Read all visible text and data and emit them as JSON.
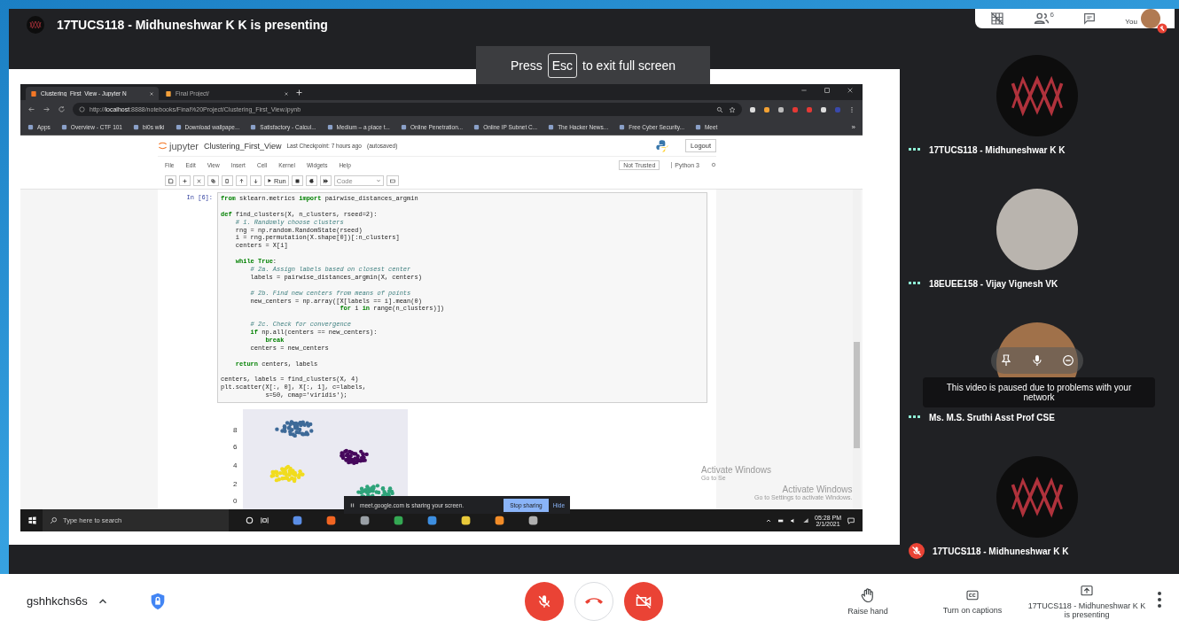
{
  "header": {
    "title": "17TUCS118 - Midhuneshwar K K is presenting"
  },
  "fullscreen_notice": {
    "before": "Press",
    "key": "Esc",
    "after": "to exit full screen"
  },
  "top_controls": {
    "participants_count": "6",
    "self_label": "You",
    "self_muted": true
  },
  "shared_screen": {
    "browser": {
      "tabs": [
        {
          "title": "Clustering_First_View - Jupyter N",
          "selected": true
        },
        {
          "title": "Final Project/",
          "selected": false
        }
      ],
      "url": "http://**localhost**:8888/notebooks/Final%20Project/Clustering_First_View.ipynb",
      "bookmarks": [
        "Apps",
        "Overview - CTF 101",
        "bi0s wiki",
        "Download wallpape...",
        "Satisfactory - Calcul...",
        "Medium – a place t...",
        "Online Penetration...",
        "Online IP Subnet C...",
        "The Hacker News...",
        "Free Cyber Security...",
        "Meet"
      ],
      "bookmarks_overflow": "»"
    },
    "notebook": {
      "logo": "jupyter",
      "name": "Clustering_First_View",
      "checkpoint": "Last Checkpoint: 7 hours ago",
      "autosave": "(autosaved)",
      "logout": "Logout",
      "menu": [
        "File",
        "Edit",
        "View",
        "Insert",
        "Cell",
        "Kernel",
        "Widgets",
        "Help"
      ],
      "trust": "Not Trusted",
      "kernel": "Python 3",
      "run_label": "Run",
      "cell_type": "Code",
      "prompt": "In [6]:",
      "code": [
        {
          "kind": "code",
          "text": "**from** sklearn.metrics **import** pairwise_distances_argmin"
        },
        {
          "kind": "blank"
        },
        {
          "kind": "code",
          "text": "**def** find_clusters(X, n_clusters, rseed=2):"
        },
        {
          "kind": "comment",
          "text": "    # 1. Randomly choose clusters"
        },
        {
          "kind": "code",
          "text": "    rng = np.random.RandomState(rseed)"
        },
        {
          "kind": "code",
          "text": "    i = rng.permutation(X.shape[0])[:n_clusters]"
        },
        {
          "kind": "code",
          "text": "    centers = X[i]"
        },
        {
          "kind": "blank"
        },
        {
          "kind": "code",
          "text": "    **while** **True**:"
        },
        {
          "kind": "comment",
          "text": "        # 2a. Assign labels based on closest center"
        },
        {
          "kind": "code",
          "text": "        labels = pairwise_distances_argmin(X, centers)"
        },
        {
          "kind": "blank"
        },
        {
          "kind": "comment",
          "text": "        # 2b. Find new centers from means of points"
        },
        {
          "kind": "code",
          "text": "        new_centers = np.array([X[labels == i].mean(0)"
        },
        {
          "kind": "code",
          "text": "                                **for** i **in** range(n_clusters)])"
        },
        {
          "kind": "blank"
        },
        {
          "kind": "comment",
          "text": "        # 2c. Check for convergence"
        },
        {
          "kind": "code",
          "text": "        **if** np.all(centers == new_centers):"
        },
        {
          "kind": "code",
          "text": "            **break**"
        },
        {
          "kind": "code",
          "text": "        centers = new_centers"
        },
        {
          "kind": "blank"
        },
        {
          "kind": "code",
          "text": "    **return** centers, labels"
        },
        {
          "kind": "blank"
        },
        {
          "kind": "code",
          "text": "centers, labels = find_clusters(X, 4)"
        },
        {
          "kind": "code",
          "text": "plt.scatter(X[:, 0], X[:, 1], c=labels,"
        },
        {
          "kind": "code",
          "text": "            s=50, cmap='viridis');"
        }
      ],
      "plot_yticks": [
        "8",
        "6",
        "4",
        "2",
        "0"
      ]
    },
    "sharing_bar": {
      "message": "meet.google.com is sharing your screen.",
      "stop": "Stop sharing",
      "hide": "Hide"
    },
    "activation_notices": [
      {
        "title": "Activate Windows",
        "note": "Go to Se"
      },
      {
        "title": "Activate Windows",
        "note": "Go to Settings to activate Windows."
      }
    ],
    "taskbar": {
      "search_placeholder": "Type here to search",
      "time": "05:28 PM",
      "date": "2/1/2021"
    }
  },
  "participants": [
    {
      "name": "17TUCS118 - Midhuneshwar K K",
      "kind": "logo",
      "muted": false,
      "controls_shown": false
    },
    {
      "name": "18EUEE158 - Vijay Vignesh VK",
      "kind": "photo",
      "muted": false,
      "controls_shown": false
    },
    {
      "name": "Ms. M.S. Sruthi Asst Prof CSE",
      "kind": "photo",
      "muted": false,
      "controls_shown": true,
      "tooltip": "This video is paused due to problems with your network"
    },
    {
      "name": "17TUCS118 - Midhuneshwar K K",
      "kind": "logo",
      "muted": true,
      "controls_shown": false
    }
  ],
  "bottom_bar": {
    "meeting_code": "gshhkchs6s",
    "mic_on": false,
    "camera_on": false,
    "actions": [
      {
        "kind": "hand",
        "label": "Raise hand"
      },
      {
        "kind": "captions",
        "label": "Turn on captions"
      },
      {
        "kind": "present",
        "label": "17TUCS118 - Midhuneshwar K K is presenting"
      }
    ]
  }
}
